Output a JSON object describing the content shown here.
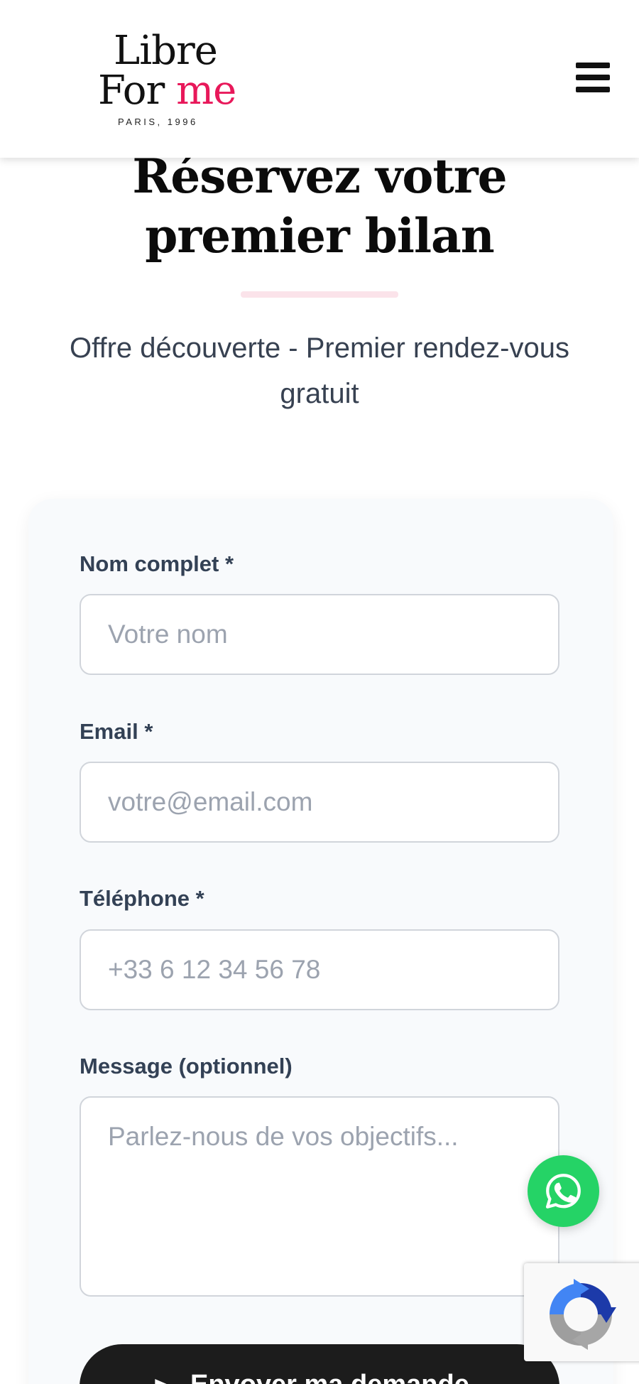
{
  "header": {
    "logo": {
      "line1": "Libre",
      "line2_plain": "For ",
      "line2_accent": "me",
      "tagline": "PARIS, 1996"
    },
    "menu_icon": "hamburger-menu-icon"
  },
  "hero": {
    "title": "Réservez votre premier bilan",
    "subtitle": "Offre découverte - Premier rendez-vous gratuit"
  },
  "form": {
    "name": {
      "label": "Nom complet *",
      "placeholder": "Votre nom",
      "value": ""
    },
    "email": {
      "label": "Email *",
      "placeholder": "votre@email.com",
      "value": ""
    },
    "phone": {
      "label": "Téléphone *",
      "placeholder": "+33 6 12 34 56 78",
      "value": ""
    },
    "message": {
      "label": "Message (optionnel)",
      "placeholder": "Parlez-nous de vos objectifs...",
      "value": ""
    },
    "submit": {
      "label": "Envoyer ma demande",
      "icon": "send-icon"
    }
  },
  "floating": {
    "whatsapp_icon": "whatsapp-icon",
    "recaptcha_icon": "recaptcha-icon"
  },
  "colors": {
    "accent": "#e8185a",
    "whatsapp": "#25d366",
    "button_dark": "#1c1c1c",
    "card_background": "#f8fafc",
    "divider": "#fbe3ea"
  }
}
